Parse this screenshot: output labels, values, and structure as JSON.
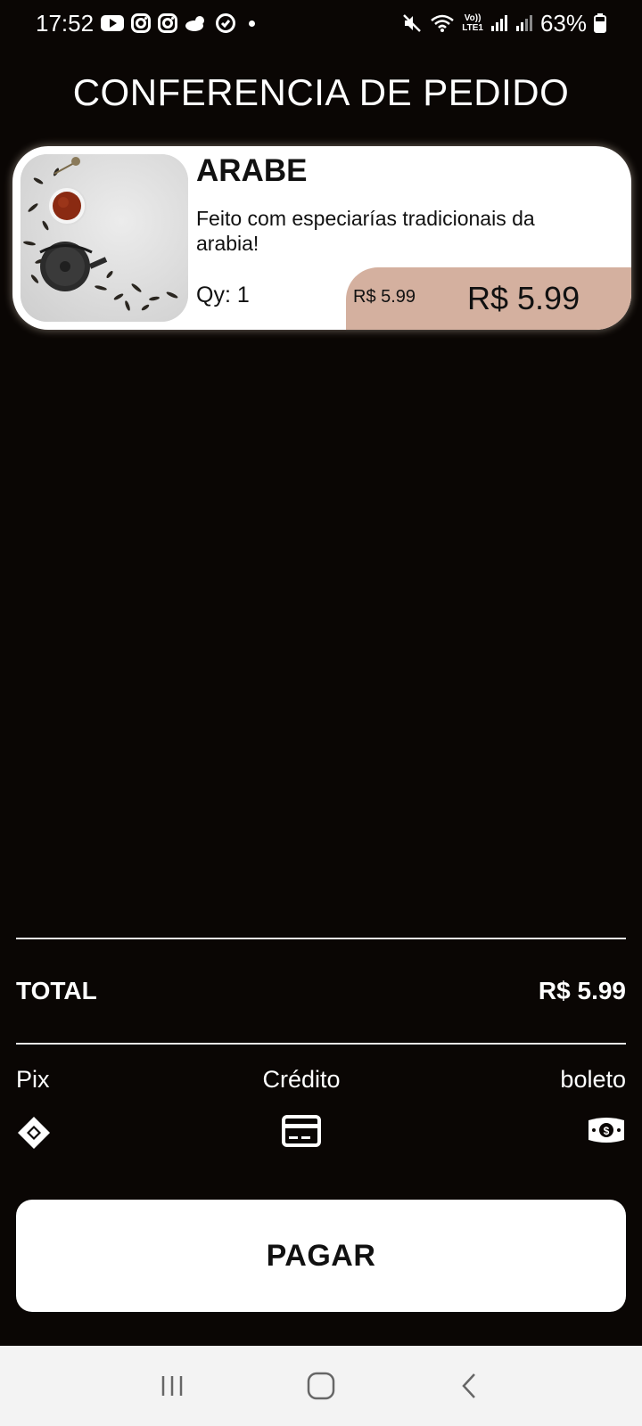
{
  "status_bar": {
    "time": "17:52",
    "battery": "63%",
    "left_icons": [
      "youtube-icon",
      "instagram-icon",
      "instagram-icon",
      "weather-icon",
      "app-icon",
      "dot-icon"
    ],
    "right_icons": [
      "mute-icon",
      "wifi-icon",
      "volte-icon",
      "signal-icon",
      "signal-icon",
      "battery-icon"
    ],
    "volte_label_top": "Vo))",
    "volte_label_bottom": "LTE1"
  },
  "header": {
    "title": "CONFERENCIA DE PEDIDO"
  },
  "order": {
    "items": [
      {
        "name": "ARABE",
        "description": "Feito com especiarías tradicionais da arabia!",
        "qty_label": "Qy: 1",
        "unit_price": "R$ 5.99",
        "total_price": "R$ 5.99",
        "image": "tea-image"
      }
    ]
  },
  "summary": {
    "total_label": "TOTAL",
    "total_value": "R$ 5.99"
  },
  "payment": {
    "options": [
      {
        "label": "Pix",
        "icon": "pix-icon"
      },
      {
        "label": "Crédito",
        "icon": "credit-card-icon"
      },
      {
        "label": "boleto",
        "icon": "cash-icon"
      }
    ],
    "pay_button_label": "PAGAR"
  },
  "colors": {
    "background": "#0a0604",
    "card": "#ffffff",
    "price_accent": "#d4b09f",
    "nav_bar": "#f3f3f3"
  },
  "nav_bar": {
    "buttons": [
      "recent-apps-icon",
      "home-icon",
      "back-icon"
    ]
  }
}
